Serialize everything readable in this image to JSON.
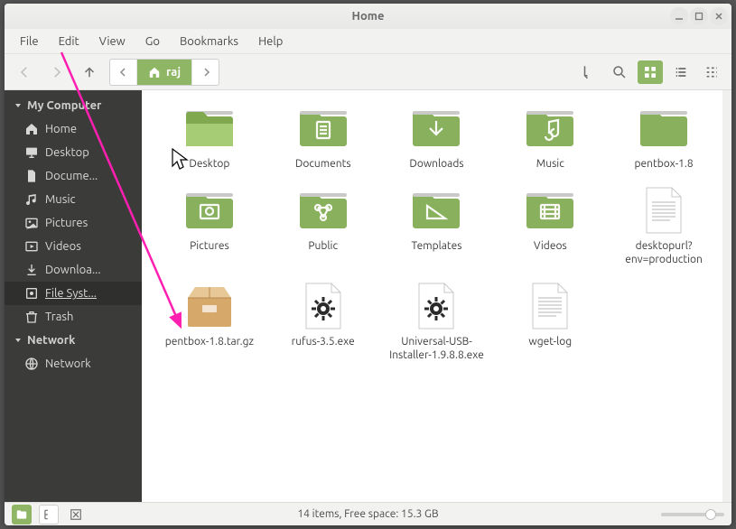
{
  "window": {
    "title": "Home"
  },
  "menubar": [
    "File",
    "Edit",
    "View",
    "Go",
    "Bookmarks",
    "Help"
  ],
  "path": {
    "current": "raj"
  },
  "sidebar": {
    "groups": [
      {
        "label": "My Computer",
        "items": [
          {
            "label": "Home",
            "icon": "home"
          },
          {
            "label": "Desktop",
            "icon": "desktop"
          },
          {
            "label": "Docume...",
            "icon": "document"
          },
          {
            "label": "Music",
            "icon": "music"
          },
          {
            "label": "Pictures",
            "icon": "picture"
          },
          {
            "label": "Videos",
            "icon": "video"
          },
          {
            "label": "Downloa...",
            "icon": "download"
          },
          {
            "label": "File Syst...",
            "icon": "disk",
            "active": true
          },
          {
            "label": "Trash",
            "icon": "trash"
          }
        ]
      },
      {
        "label": "Network",
        "items": [
          {
            "label": "Network",
            "icon": "network"
          }
        ]
      }
    ]
  },
  "items": [
    {
      "name": "Desktop",
      "kind": "folder-desktop"
    },
    {
      "name": "Documents",
      "kind": "folder-documents"
    },
    {
      "name": "Downloads",
      "kind": "folder-downloads"
    },
    {
      "name": "Music",
      "kind": "folder-music"
    },
    {
      "name": "pentbox-1.8",
      "kind": "folder-plain"
    },
    {
      "name": "Pictures",
      "kind": "folder-pictures"
    },
    {
      "name": "Public",
      "kind": "folder-public"
    },
    {
      "name": "Templates",
      "kind": "folder-templates"
    },
    {
      "name": "Videos",
      "kind": "folder-videos"
    },
    {
      "name": "desktopurl?env=production",
      "kind": "text"
    },
    {
      "name": "pentbox-1.8.tar.gz",
      "kind": "archive"
    },
    {
      "name": "rufus-3.5.exe",
      "kind": "exe"
    },
    {
      "name": "Universal-USB-Installer-1.9.8.8.exe",
      "kind": "exe"
    },
    {
      "name": "wget-log",
      "kind": "text"
    }
  ],
  "status": {
    "text": "14 items, Free space: 15.3 GB",
    "zoom": 0.85
  },
  "colors": {
    "accent": "#8eb664",
    "folder": "#89b05c",
    "folderDark": "#6f9547"
  }
}
